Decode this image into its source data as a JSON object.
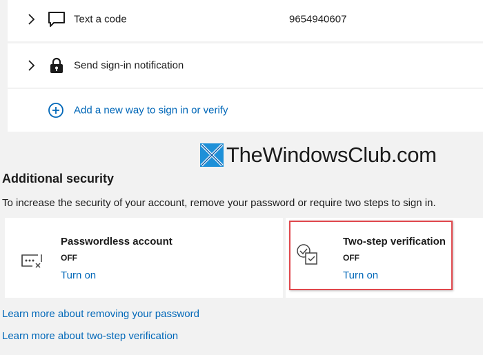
{
  "methods": [
    {
      "label": "Text a code",
      "value": "9654940607",
      "icon": "chat-bubble-icon"
    },
    {
      "label": "Send sign-in notification",
      "value": "",
      "icon": "lock-icon"
    }
  ],
  "add_method": {
    "label": "Add a new way to sign in or verify",
    "icon": "plus-circle-icon"
  },
  "watermark": {
    "text": "TheWindowsClub.com"
  },
  "additional_security": {
    "title": "Additional security",
    "description": "To increase the security of your account, remove your password or require two steps to sign in.",
    "options": [
      {
        "title": "Passwordless account",
        "status": "OFF",
        "action": "Turn on",
        "icon": "password-field-icon"
      },
      {
        "title": "Two-step verification",
        "status": "OFF",
        "action": "Turn on",
        "icon": "two-step-check-icon"
      }
    ]
  },
  "links": {
    "learn_passwordless": "Learn more about removing your password",
    "learn_two_step": "Learn more about two-step verification"
  },
  "colors": {
    "accent": "#0067b8",
    "highlight": "#e0474c",
    "background": "#f2f2f2"
  }
}
